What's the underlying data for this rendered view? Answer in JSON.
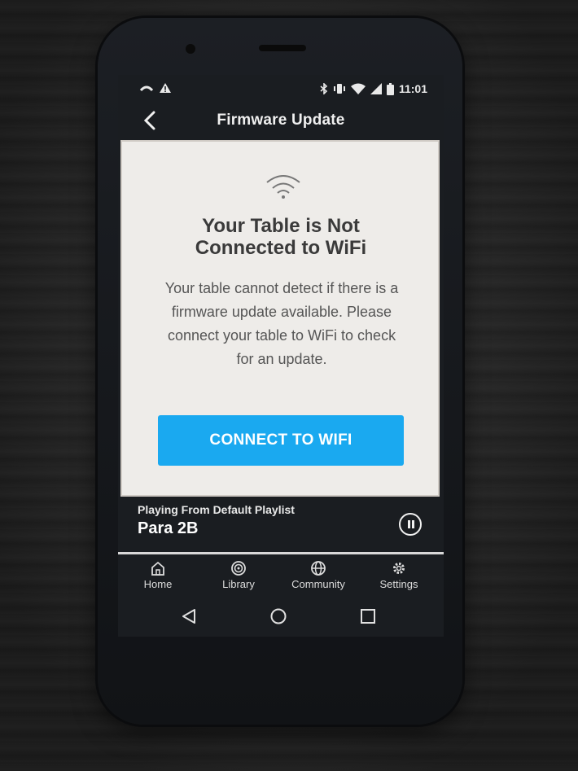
{
  "status_bar": {
    "time": "11:01"
  },
  "app_bar": {
    "title": "Firmware Update",
    "back_icon": "chevron-left-icon"
  },
  "card": {
    "icon": "wifi-icon",
    "title_line1": "Your Table is Not",
    "title_line2": "Connected to WiFi",
    "body": "Your table cannot detect if there is a firmware update available. Please connect your table to WiFi to check for an update.",
    "button_label": "CONNECT TO WIFI",
    "button_color": "#1aa9f0"
  },
  "now_playing": {
    "label": "Playing From Default Playlist",
    "track": "Para 2B",
    "control_icon": "pause-icon"
  },
  "tabs": [
    {
      "label": "Home",
      "icon": "home-icon"
    },
    {
      "label": "Library",
      "icon": "library-icon"
    },
    {
      "label": "Community",
      "icon": "globe-icon"
    },
    {
      "label": "Settings",
      "icon": "gear-icon"
    }
  ],
  "system_nav": [
    "back-icon",
    "home-circle-icon",
    "recents-icon"
  ]
}
